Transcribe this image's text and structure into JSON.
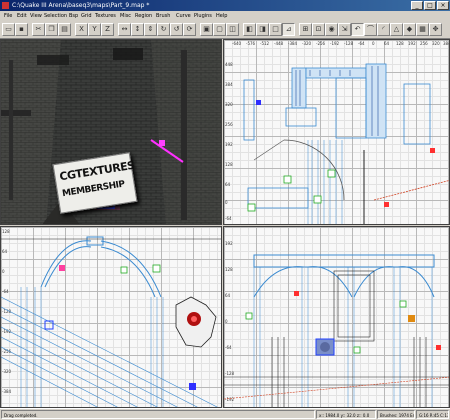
{
  "window": {
    "title": "C:\\Quake III Arena\\baseq3\\maps\\Part_9.map *"
  },
  "window_buttons": {
    "minimize": "_",
    "maximize": "□",
    "close": "×"
  },
  "menu": [
    "File",
    "Edit",
    "View",
    "Selection",
    "Bsp",
    "Grid",
    "Textures",
    "Misc",
    "Region",
    "Brush",
    "Curve",
    "Plugins",
    "Help"
  ],
  "toolbar_icons": [
    "open-icon",
    "save-icon",
    "cut-icon",
    "copy-icon",
    "paste-icon",
    "x-axis-icon",
    "y-axis-icon",
    "z-axis-icon",
    "flip-x-icon",
    "flip-y-icon",
    "flip-z-icon",
    "rotate-x-icon",
    "rotate-y-icon",
    "rotate-z-icon",
    "select-touching-icon",
    "select-inside-icon",
    "select-complete-icon",
    "csg-subtract-icon",
    "csg-merge-icon",
    "hollow-icon",
    "clipper-icon",
    "change-views-icon",
    "texture-lock-icon",
    "camera-icon",
    "scale-icon",
    "rotate-icon",
    "patch-icon",
    "patch-bevel-icon",
    "patch-cone-icon",
    "show-entities-icon",
    "cubic-clip-icon",
    "drag-tool-icon",
    "region-icon"
  ],
  "sign": {
    "line1": "CGTEXTURES",
    "line2": "MEMBERSHIP"
  },
  "xy_top_ruler": [
    "-640",
    "-576",
    "-512",
    "-448",
    "-384",
    "-320",
    "-256",
    "-192",
    "-128",
    "-64",
    "0",
    "64",
    "128",
    "192",
    "256",
    "320",
    "384"
  ],
  "xy_left_ruler": [
    "448",
    "384",
    "320",
    "256",
    "192",
    "128",
    "64",
    "0",
    "-64"
  ],
  "xz_left_ruler": [
    "128",
    "64",
    "0",
    "-64",
    "-128",
    "-192",
    "-256",
    "-320",
    "-384"
  ],
  "yz_left_ruler": [
    "192",
    "128",
    "64",
    "0",
    "-64",
    "-128",
    "-192"
  ],
  "status": {
    "message": "Drag completed.",
    "coords": "x:: 1984.0  y:: 32.0  z:: 0.0",
    "brushes": "Brushes: 1974  Entities: 78",
    "grid": "G:16 R:45 C:13 L:MR"
  }
}
